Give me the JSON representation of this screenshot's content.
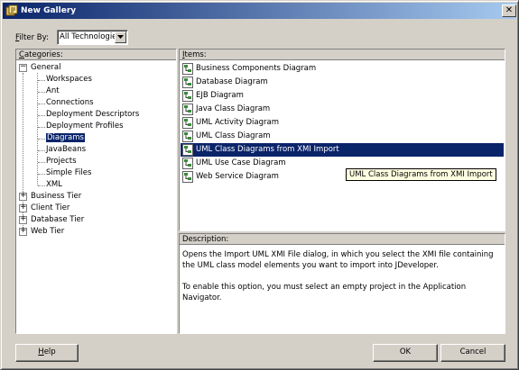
{
  "window": {
    "title": "New Gallery",
    "close_glyph": "✕"
  },
  "filter": {
    "label": "Filter By:",
    "value": "All Technologies"
  },
  "categories": {
    "header": "Categories:",
    "general": "General",
    "general_children": [
      "Workspaces",
      "Ant",
      "Connections",
      "Deployment Descriptors",
      "Deployment Profiles",
      "Diagrams",
      "JavaBeans",
      "Projects",
      "Simple Files",
      "XML"
    ],
    "selected": "Diagrams",
    "collapsed": [
      "Business Tier",
      "Client Tier",
      "Database Tier",
      "Web Tier"
    ]
  },
  "items": {
    "header": "Items:",
    "list": [
      "Business Components Diagram",
      "Database Diagram",
      "EJB Diagram",
      "Java Class Diagram",
      "UML Activity Diagram",
      "UML Class Diagram",
      "UML Class Diagrams from XMI Import",
      "UML Use Case Diagram",
      "Web Service Diagram"
    ],
    "selected": "UML Class Diagrams from XMI Import",
    "icon": "diagram-icon"
  },
  "tooltip": "UML Class Diagrams from XMI Import",
  "description": {
    "header": "Description:",
    "para1": "Opens the Import UML XMI File dialog, in which you select the XMI file containing the UML class model elements you want to import into JDeveloper.",
    "para2": "To enable this option, you must select an empty project in the Application Navigator."
  },
  "buttons": {
    "help": "Help",
    "ok": "OK",
    "cancel": "Cancel"
  },
  "colors": {
    "selection": "#0a246a",
    "face": "#d4d0c8",
    "title_start": "#0a246a",
    "title_end": "#a6caf0"
  }
}
